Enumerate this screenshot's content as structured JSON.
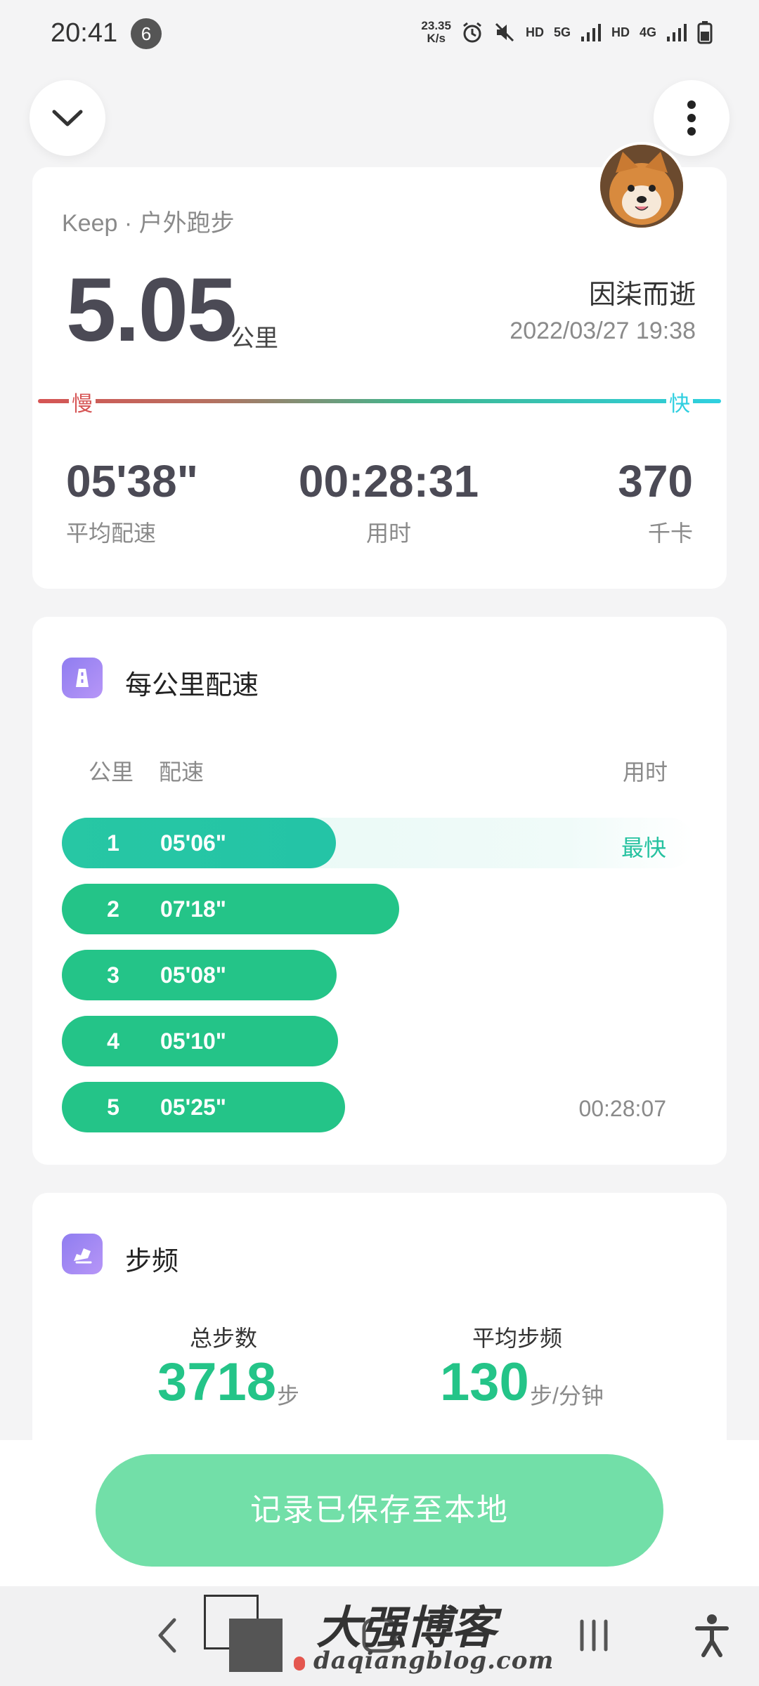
{
  "status_bar": {
    "time": "20:41",
    "notification_count": "6",
    "net_speed_value": "23.35",
    "net_speed_unit": "K/s",
    "hd_1": "HD",
    "network_5g": "5G",
    "hd_2": "HD",
    "network_4g": "4G"
  },
  "summary": {
    "app_label": "Keep · 户外跑步",
    "distance": "5.05",
    "distance_unit": "公里",
    "user_name": "因柒而逝",
    "datetime": "2022/03/27 19:38",
    "slow_label": "慢",
    "fast_label": "快",
    "avg_pace": "05'38\"",
    "avg_pace_label": "平均配速",
    "duration": "00:28:31",
    "duration_label": "用时",
    "calories": "370",
    "calories_label": "千卡"
  },
  "pace_section": {
    "title": "每公里配速",
    "col_km": "公里",
    "col_pace": "配速",
    "col_time": "用时",
    "fastest_tag": "最快",
    "total_time": "00:28:07",
    "rows": [
      {
        "km": "1",
        "pace": "05'06\"",
        "seconds": 306
      },
      {
        "km": "2",
        "pace": "07'18\"",
        "seconds": 438
      },
      {
        "km": "3",
        "pace": "05'08\"",
        "seconds": 308
      },
      {
        "km": "4",
        "pace": "05'10\"",
        "seconds": 310
      },
      {
        "km": "5",
        "pace": "05'25\"",
        "seconds": 325
      }
    ]
  },
  "cadence_section": {
    "title": "步频",
    "total_steps_label": "总步数",
    "total_steps": "3718",
    "total_steps_unit": "步",
    "avg_cadence_label": "平均步频",
    "avg_cadence": "130",
    "avg_cadence_unit": "步/分钟"
  },
  "save_button": {
    "label": "记录已保存至本地"
  },
  "watermark": {
    "text": "大强博客",
    "url": "daqiangblog.com"
  },
  "colors": {
    "accent": "#24c488",
    "save_button": "#72dfa8",
    "slow": "#d65454",
    "fast": "#2fcfe0",
    "section_icon": "#8f7df0"
  }
}
